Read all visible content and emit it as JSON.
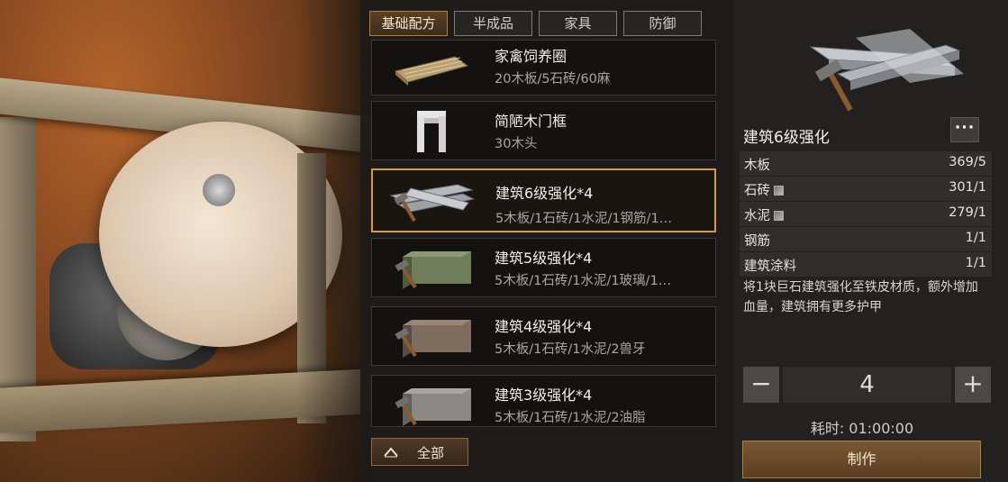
{
  "tabs": [
    {
      "label": "基础配方",
      "active": true
    },
    {
      "label": "半成品",
      "active": false
    },
    {
      "label": "家具",
      "active": false
    },
    {
      "label": "防御",
      "active": false
    }
  ],
  "recipes": [
    {
      "name": "家禽饲养圈",
      "cost": "20木板/5石砖/60麻",
      "icon": "poultry-pen"
    },
    {
      "name": "简陋木门框",
      "cost": "30木头",
      "icon": "door-frame"
    },
    {
      "name": "建筑6级强化*4",
      "cost": "5木板/1石砖/1水泥/1钢筋/1…",
      "icon": "steel-bars",
      "selected": true
    },
    {
      "name": "建筑5级强化*4",
      "cost": "5木板/1石砖/1水泥/1玻璃/1…",
      "icon": "green-block"
    },
    {
      "name": "建筑4级强化*4",
      "cost": "5木板/1石砖/1水泥/2兽牙",
      "icon": "brown-block"
    },
    {
      "name": "建筑3级强化*4",
      "cost": "5木板/1石砖/1水泥/2油脂",
      "icon": "grey-block"
    }
  ],
  "all_button": "全部",
  "detail": {
    "title": "建筑6级强化",
    "more_label": "···",
    "materials": [
      {
        "name": "木板",
        "qty": "369/5",
        "has_icon": false
      },
      {
        "name": "石砖",
        "qty": "301/1",
        "has_icon": true
      },
      {
        "name": "水泥",
        "qty": "279/1",
        "has_icon": true
      },
      {
        "name": "钢筋",
        "qty": "1/1",
        "has_icon": false
      },
      {
        "name": "建筑涂料",
        "qty": "1/1",
        "has_icon": false
      }
    ],
    "description": "将1块巨石建筑强化至铁皮材质，额外增加血量，建筑拥有更多护甲",
    "quantity": "4",
    "minus": "−",
    "plus": "+",
    "time": "耗时: 01:00:00",
    "craft_button": "制作"
  },
  "colors": {
    "accent": "#d89a45",
    "panel": "#222120"
  }
}
